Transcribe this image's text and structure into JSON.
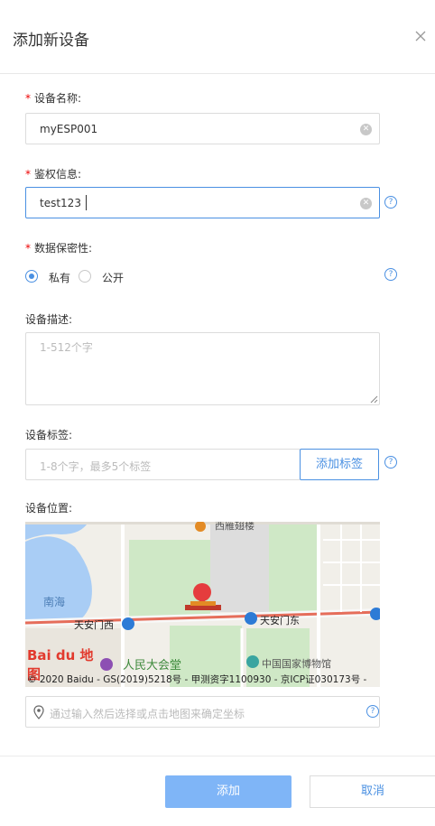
{
  "dialog": {
    "title": "添加新设备"
  },
  "fields": {
    "name": {
      "label": "设备名称:",
      "value": "myESP001"
    },
    "auth": {
      "label": "鉴权信息:",
      "value": "test123"
    },
    "secrecy": {
      "label": "数据保密性:",
      "options": [
        "私有",
        "公开"
      ],
      "selected": "私有"
    },
    "description": {
      "label": "设备描述:",
      "placeholder": "1-512个字"
    },
    "tags": {
      "label": "设备标签:",
      "placeholder": "1-8个字，最多5个标签",
      "add_button": "添加标签"
    },
    "location": {
      "label": "设备位置:",
      "search_placeholder": "通过输入然后选择或点击地图来确定坐标",
      "map": {
        "place_labels": [
          "西雁翅楼",
          "南海",
          "天安门西",
          "天安门东",
          "人民大会堂",
          "中国国家博物馆"
        ],
        "logo_text": "Bai du 地图",
        "copyright": "© 2020 Baidu - GS(2019)5218号 - 甲测资字1100930 - 京ICP证030173号 -"
      }
    }
  },
  "footer": {
    "add_button": "添加",
    "cancel_button": "取消"
  },
  "colors": {
    "accent": "#4a90e2",
    "required": "#e00000",
    "primary_disabled": "#7fb5f7"
  }
}
